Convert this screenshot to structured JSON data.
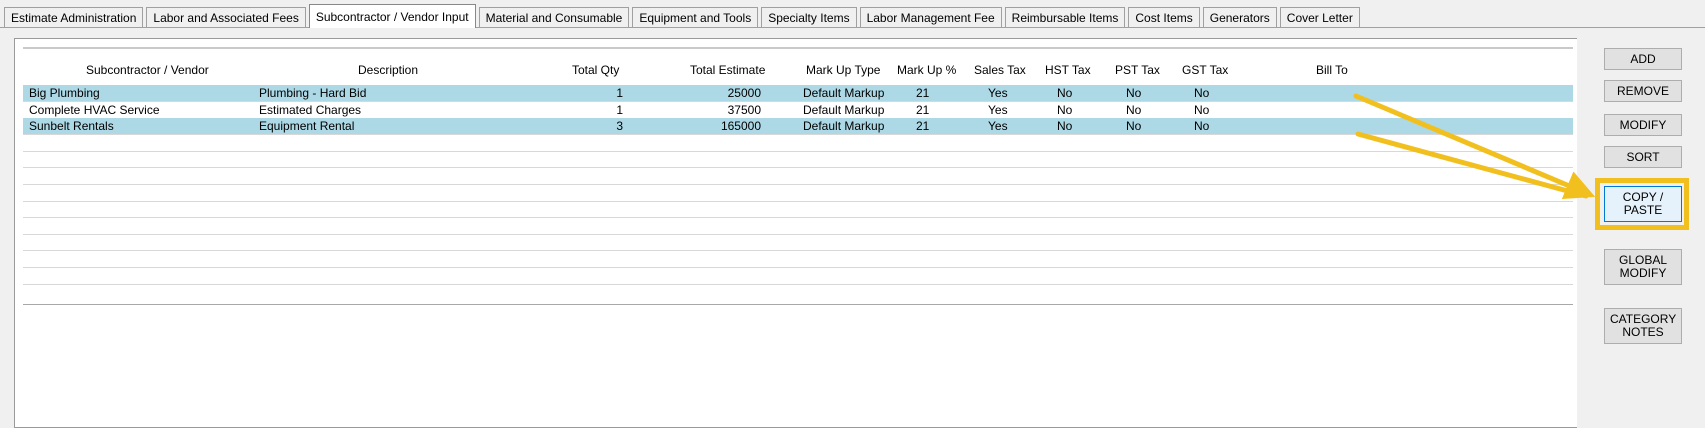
{
  "tabs": [
    {
      "label": "Estimate Administration",
      "active": false
    },
    {
      "label": "Labor and Associated Fees",
      "active": false
    },
    {
      "label": "Subcontractor / Vendor Input",
      "active": true
    },
    {
      "label": "Material and Consumable",
      "active": false
    },
    {
      "label": "Equipment and Tools",
      "active": false
    },
    {
      "label": "Specialty Items",
      "active": false
    },
    {
      "label": "Labor Management Fee",
      "active": false
    },
    {
      "label": "Reimbursable Items",
      "active": false
    },
    {
      "label": "Cost Items",
      "active": false
    },
    {
      "label": "Generators",
      "active": false
    },
    {
      "label": "Cover Letter",
      "active": false
    }
  ],
  "grid": {
    "columns": {
      "vendor": "Subcontractor / Vendor",
      "description": "Description",
      "qty": "Total Qty",
      "estimate": "Total Estimate",
      "markup_type": "Mark Up Type",
      "markup_pct": "Mark Up %",
      "sales_tax": "Sales Tax",
      "hst_tax": "HST Tax",
      "pst_tax": "PST Tax",
      "gst_tax": "GST Tax",
      "bill_to": "Bill To"
    },
    "rows": [
      {
        "vendor": "Big Plumbing",
        "description": "Plumbing - Hard Bid",
        "qty": "1",
        "estimate": "25000",
        "markup_type": "Default Markup",
        "markup_pct": "21",
        "sales_tax": "Yes",
        "hst_tax": "No",
        "pst_tax": "No",
        "gst_tax": "No",
        "bill_to": "",
        "selected": true
      },
      {
        "vendor": "Complete HVAC Service",
        "description": "Estimated Charges",
        "qty": "1",
        "estimate": "37500",
        "markup_type": "Default Markup",
        "markup_pct": "21",
        "sales_tax": "Yes",
        "hst_tax": "No",
        "pst_tax": "No",
        "gst_tax": "No",
        "bill_to": "",
        "selected": false
      },
      {
        "vendor": "Sunbelt Rentals",
        "description": "Equipment Rental",
        "qty": "3",
        "estimate": "165000",
        "markup_type": "Default Markup",
        "markup_pct": "21",
        "sales_tax": "Yes",
        "hst_tax": "No",
        "pst_tax": "No",
        "gst_tax": "No",
        "bill_to": "",
        "selected": true
      }
    ],
    "empty_rows": 9
  },
  "buttons": {
    "add": "ADD",
    "remove": "REMOVE",
    "modify": "MODIFY",
    "sort": "SORT",
    "copy_paste": "COPY / PASTE",
    "global_modify": "GLOBAL MODIFY",
    "category_notes": "CATEGORY NOTES"
  },
  "colors": {
    "selected_row": "#add8e6",
    "highlight": "#f2c01e"
  }
}
